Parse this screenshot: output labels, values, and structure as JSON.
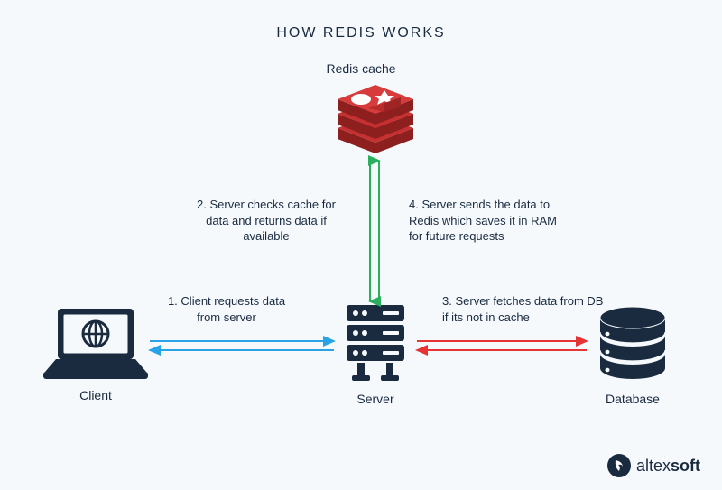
{
  "title": "HOW REDIS WORKS",
  "nodes": {
    "redis": "Redis cache",
    "client": "Client",
    "server": "Server",
    "database": "Database"
  },
  "steps": {
    "s1": {
      "num": "1.",
      "text": "Client requests data from server"
    },
    "s2": {
      "num": "2.",
      "text": "Server checks cache for data and returns data if available"
    },
    "s3": {
      "num": "3.",
      "text": "Server fetches data from DB if its not in cache"
    },
    "s4": {
      "num": "4.",
      "text": "Server sends the data to Redis which saves it in RAM for future requests"
    }
  },
  "colors": {
    "blue": "#29a3e6",
    "green": "#2aaf5e",
    "red": "#e63333",
    "navy": "#1a2b3f",
    "redis": "#c73030"
  },
  "brand": {
    "name": "altexsoft",
    "bold": "soft"
  }
}
